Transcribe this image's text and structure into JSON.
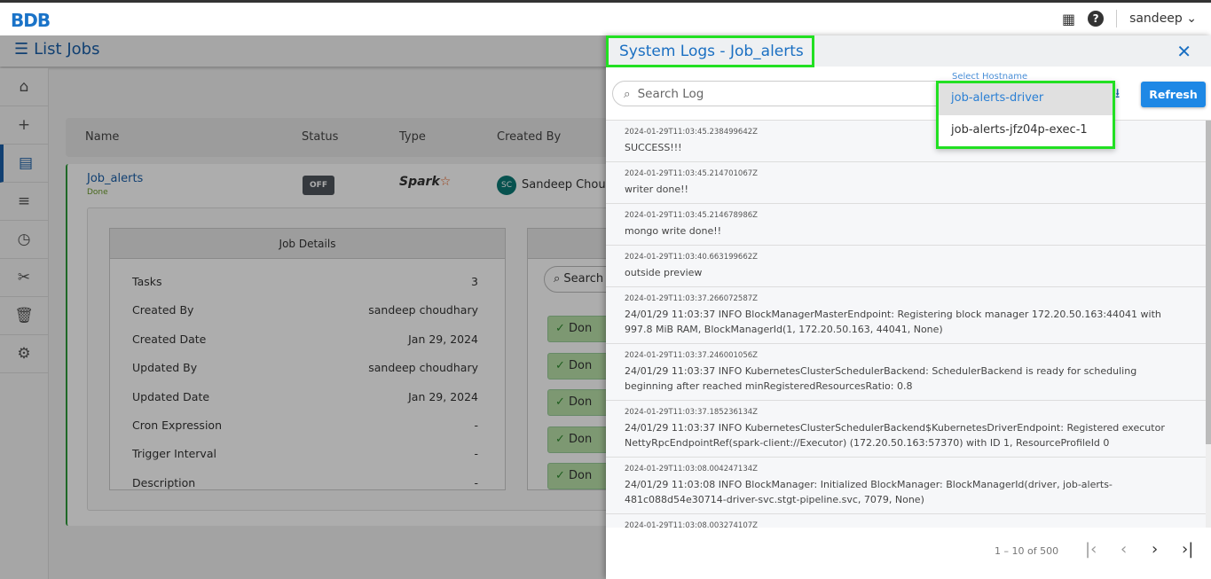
{
  "app": {
    "logo": "BDB",
    "user": "sandeep",
    "icons": [
      "apps-grid-icon",
      "help-icon"
    ]
  },
  "page": {
    "title": "List Jobs"
  },
  "sidebar": [
    "home-icon",
    "plus-icon",
    "jobs-icon",
    "list-icon",
    "clock-icon",
    "scissors-icon",
    "trash-icon",
    "gear-icon"
  ],
  "table": {
    "headers": [
      "Name",
      "Status",
      "Type",
      "Created By"
    ],
    "row": {
      "name": "Job_alerts",
      "state": "Done",
      "toggle": "OFF",
      "type": "Spark",
      "avatar": "SC",
      "created_by": "Sandeep Choudh"
    }
  },
  "job_details": {
    "title": "Job Details",
    "rows": [
      {
        "k": "Tasks",
        "v": "3"
      },
      {
        "k": "Created By",
        "v": "sandeep choudhary"
      },
      {
        "k": "Created Date",
        "v": "Jan 29, 2024"
      },
      {
        "k": "Updated By",
        "v": "sandeep choudhary"
      },
      {
        "k": "Updated Date",
        "v": "Jan 29, 2024"
      },
      {
        "k": "Cron Expression",
        "v": "-"
      },
      {
        "k": "Trigger Interval",
        "v": "-"
      },
      {
        "k": "Description",
        "v": "-"
      }
    ]
  },
  "tasks_panel": {
    "search": "Search",
    "items": [
      "Don",
      "Don",
      "Don",
      "Don",
      "Don"
    ]
  },
  "drawer": {
    "title": "System Logs - Job_alerts",
    "search_placeholder": "Search Log",
    "host_label": "Select Hostname",
    "host_options": [
      "job-alerts-driver",
      "job-alerts-jfz04p-exec-1"
    ],
    "refresh": "Refresh",
    "logs": [
      {
        "ts": "2024-01-29T11:03:45.238499642Z",
        "msg": "SUCCESS!!!"
      },
      {
        "ts": "2024-01-29T11:03:45.214701067Z",
        "msg": "writer done!!"
      },
      {
        "ts": "2024-01-29T11:03:45.214678986Z",
        "msg": "mongo write done!!"
      },
      {
        "ts": "2024-01-29T11:03:40.663199662Z",
        "msg": "outside preview"
      },
      {
        "ts": "2024-01-29T11:03:37.266072587Z",
        "msg": "24/01/29 11:03:37 INFO BlockManagerMasterEndpoint: Registering block manager 172.20.50.163:44041 with 997.8 MiB RAM, BlockManagerId(1, 172.20.50.163, 44041, None)"
      },
      {
        "ts": "2024-01-29T11:03:37.246001056Z",
        "msg": "24/01/29 11:03:37 INFO KubernetesClusterSchedulerBackend: SchedulerBackend is ready for scheduling beginning after reached minRegisteredResourcesRatio: 0.8"
      },
      {
        "ts": "2024-01-29T11:03:37.185236134Z",
        "msg": "24/01/29 11:03:37 INFO KubernetesClusterSchedulerBackend$KubernetesDriverEndpoint: Registered executor NettyRpcEndpointRef(spark-client://Executor) (172.20.50.163:57370) with ID 1, ResourceProfileId 0"
      },
      {
        "ts": "2024-01-29T11:03:08.004247134Z",
        "msg": "24/01/29 11:03:08 INFO BlockManager: Initialized BlockManager: BlockManagerId(driver, job-alerts-481c088d54e30714-driver-svc.stgt-pipeline.svc, 7079, None)"
      },
      {
        "ts": "2024-01-29T11:03:08.003274107Z",
        "msg": ""
      }
    ],
    "pagination": {
      "range": "1 – 10 of 500"
    }
  }
}
